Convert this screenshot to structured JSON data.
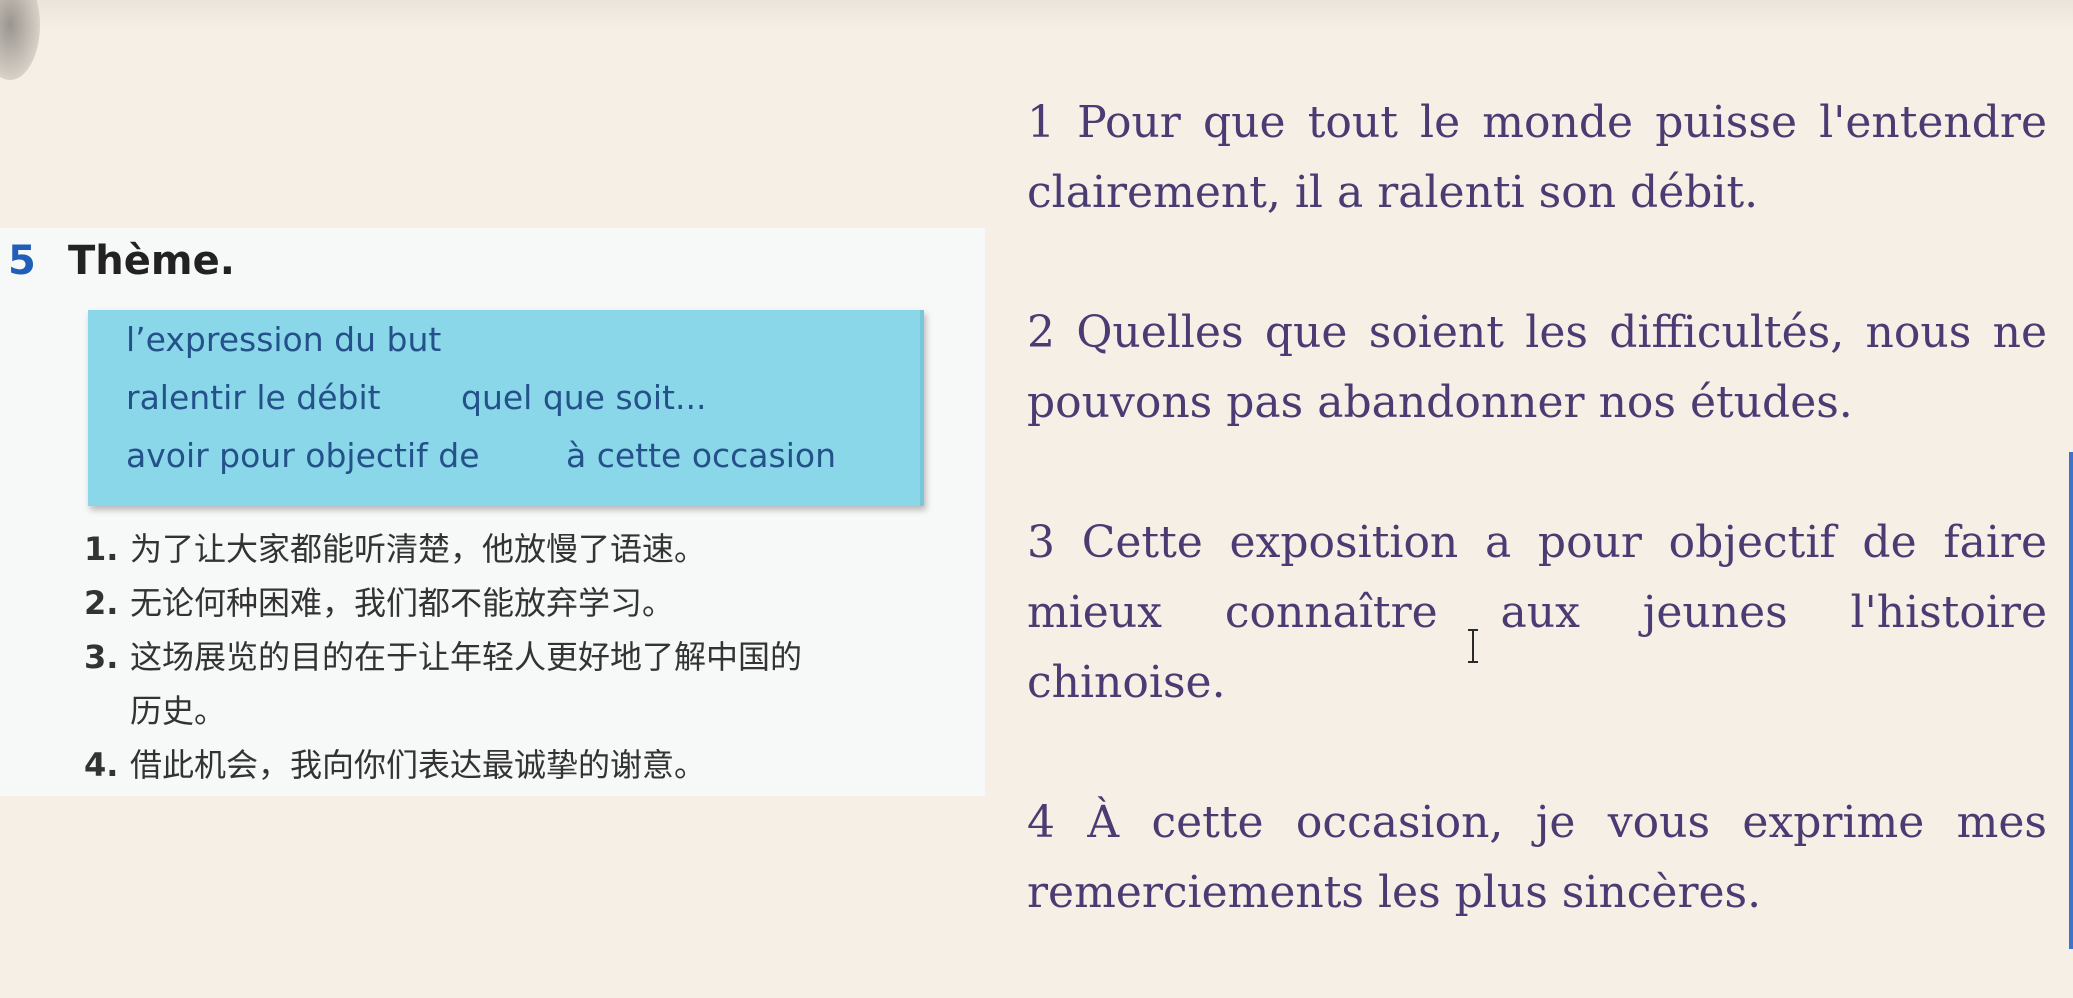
{
  "textbook": {
    "exercise_number": "5",
    "exercise_title": "Thème.",
    "theme_box": {
      "items": [
        "l’expression du but",
        "ralentir le débit",
        "quel que soit...",
        "avoir pour objectif de",
        "à cette occasion"
      ]
    },
    "sentences": [
      {
        "num": "1.",
        "text": "为了让大家都能听清楚，他放慢了语速。"
      },
      {
        "num": "2.",
        "text": "无论何种困难，我们都不能放弃学习。"
      },
      {
        "num": "3.",
        "text": "这场展览的目的在于让年轻人更好地了解中国的",
        "cont": "历史。"
      },
      {
        "num": "4.",
        "text": "借此机会，我向你们表达最诚挚的谢意。"
      }
    ]
  },
  "translations": [
    "1 Pour que tout le monde puisse l'entendre clairement, il a ralenti son débit.",
    "2 Quelles que soient les difficultés, nous ne pouvons pas abandonner nos études.",
    "3 Cette exposition a pour objectif de faire mieux connaître aux jeunes l'histoire chinoise.",
    "4 À cette occasion, je vous exprime mes remerciements les plus sincères."
  ],
  "colors": {
    "background": "#f5efe6",
    "translation_text": "#4a3b73",
    "theme_box": "#8bd7ea",
    "exercise_number": "#1f5fb8"
  },
  "icons": {
    "cursor": "text-cursor-icon"
  }
}
